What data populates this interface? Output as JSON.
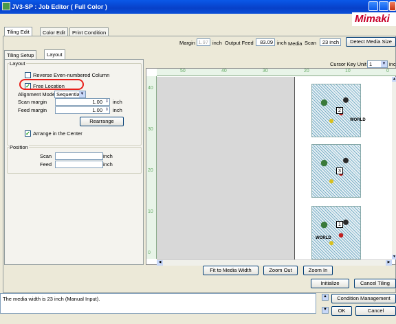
{
  "window": {
    "title": "JV3-SP : Job Editor ( Full Color )",
    "logo": "Mimaki"
  },
  "main_tabs": [
    {
      "label": "Tiling Edit",
      "active": true
    },
    {
      "label": "Color Edit",
      "active": false
    },
    {
      "label": "Print Condition",
      "active": false
    }
  ],
  "info_bar": {
    "margin_label": "Margin",
    "margin_value": "1.97",
    "unit1": "inch",
    "output_feed_label": "Output Feed",
    "output_feed_value": "83.09",
    "unit2": "inch",
    "media_label": "Media",
    "scan_label": "Scan",
    "scan_value": "23 inch",
    "detect_button": "Detect Media Size"
  },
  "sub_tabs": [
    {
      "label": "Tiling Setup",
      "active": false
    },
    {
      "label": "Layout",
      "active": true
    }
  ],
  "layout": {
    "group_label": "Layout",
    "reverse_label": "Reverse Even-numbered Column",
    "reverse_checked": false,
    "free_location_label": "Free Location",
    "free_location_checked": true,
    "alignment_label": "Alignment Mode",
    "alignment_value": "Sequential",
    "scan_margin_label": "Scan margin",
    "scan_margin_value": "1.00",
    "feed_margin_label": "Feed margin",
    "feed_margin_value": "1.00",
    "unit": "inch",
    "rearrange_button": "Rearrange",
    "arrange_center_label": "Arrange in the Center",
    "arrange_center_checked": true
  },
  "position": {
    "group_label": "Position",
    "scan_label": "Scan",
    "feed_label": "Feed",
    "unit": "inch"
  },
  "preview": {
    "cursor_key_unit_label": "Cursor Key Unit",
    "cursor_key_unit_value": "1",
    "cursor_unit": "inch",
    "hruler_numbers": [
      "50",
      "40",
      "30",
      "20",
      "10",
      "0"
    ],
    "vruler_numbers": [
      "40",
      "30",
      "20",
      "10",
      "0"
    ],
    "page_numbers": [
      "2",
      "3",
      "1"
    ],
    "map_caption": "WORLD"
  },
  "zoom_buttons": {
    "fit": "Fit to Media Width",
    "zoom_out": "Zoom Out",
    "zoom_in": "Zoom In"
  },
  "bottom_buttons": {
    "initialize": "Initialize",
    "cancel_tiling": "Cancel Tiling",
    "condition_management": "Condition Management",
    "ok": "OK",
    "cancel": "Cancel"
  },
  "status": {
    "message": "The media width is 23 inch (Manual Input)."
  }
}
